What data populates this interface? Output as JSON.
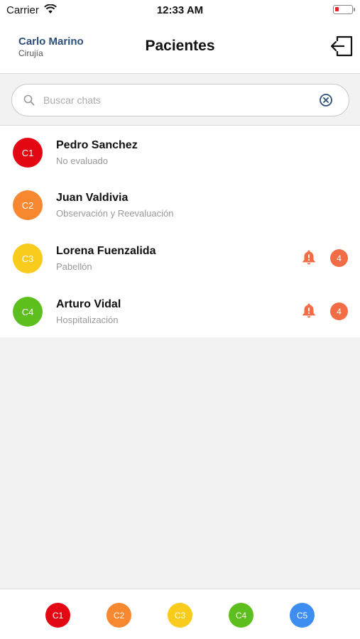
{
  "status_bar": {
    "carrier": "Carrier",
    "time": "12:33 AM"
  },
  "header": {
    "user_name": "Carlo Marino",
    "user_role": "Cirujía",
    "title": "Pacientes"
  },
  "search": {
    "placeholder": "Buscar chats"
  },
  "patients": [
    {
      "initials": "C1",
      "name": "Pedro Sanchez",
      "status": "No evaluado",
      "color": "#e30613",
      "notifications": null
    },
    {
      "initials": "C2",
      "name": "Juan Valdivia",
      "status": "Observación y Reevaluación",
      "color": "#f7882f",
      "notifications": null
    },
    {
      "initials": "C3",
      "name": "Lorena Fuenzalida",
      "status": "Pabellón",
      "color": "#f9cb1c",
      "notifications": "4"
    },
    {
      "initials": "C4",
      "name": "Arturo Vidal",
      "status": "Hospitalización",
      "color": "#5cbf1e",
      "notifications": "4"
    }
  ],
  "category_tabs": [
    {
      "label": "C1",
      "color": "#e30613"
    },
    {
      "label": "C2",
      "color": "#f7882f"
    },
    {
      "label": "C3",
      "color": "#f9cb1c"
    },
    {
      "label": "C4",
      "color": "#5cbf1e"
    },
    {
      "label": "C5",
      "color": "#3d8ef0"
    }
  ],
  "colors": {
    "alert": "#f26d45",
    "user_name": "#2c4f7a",
    "battery_low": "#e0242b"
  }
}
